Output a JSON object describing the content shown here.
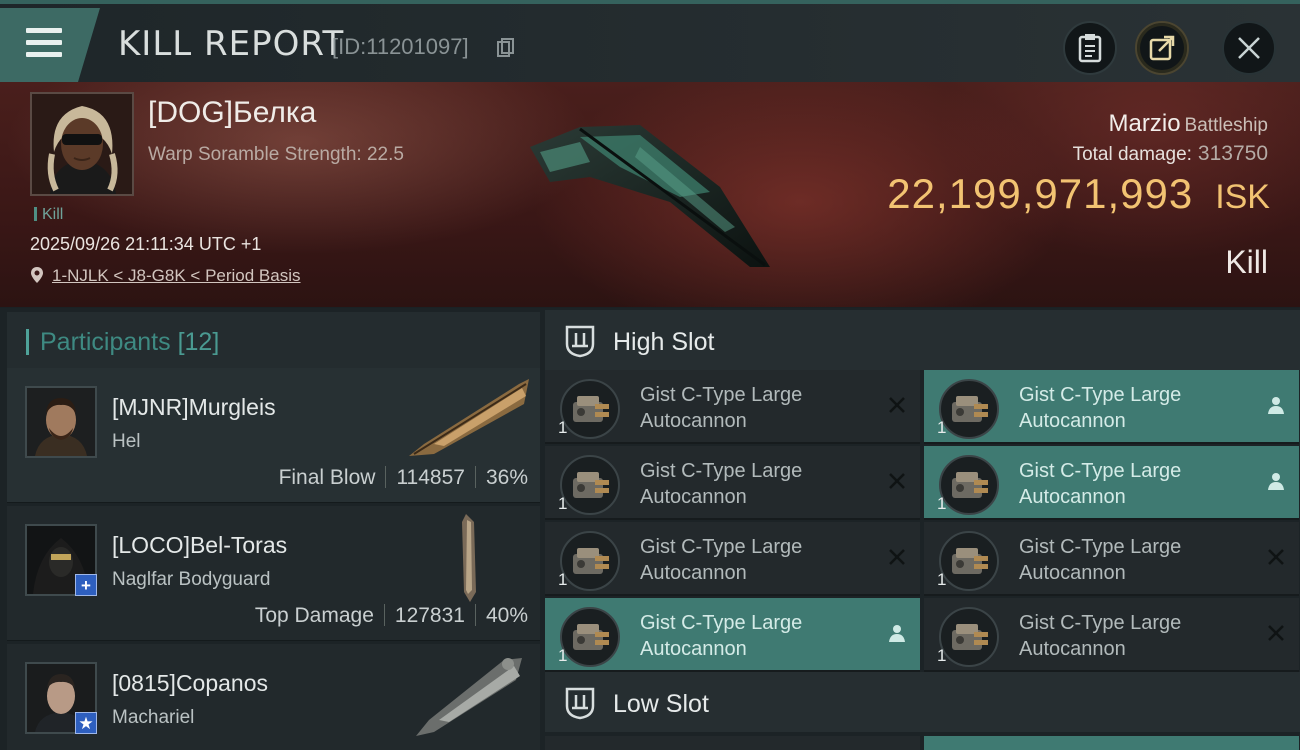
{
  "header": {
    "title": "KILL REPORT",
    "report_id": "[ID:11201097]",
    "icons": [
      "menu-icon",
      "copy-icon",
      "clipboard-icon",
      "share-icon",
      "close-icon"
    ]
  },
  "victim": {
    "name": "[DOG]Белка",
    "warp_scramble": "Warp Soramble Strength: 22.5",
    "tag": "Kill",
    "datetime": "2025/09/26 21:11:34 UTC +1",
    "location": "1-NJLK < J8-G8K < Period Basis",
    "ship_name": "Marzio",
    "ship_class": "Battleship",
    "total_damage_label": "Total damage:",
    "total_damage": "313750",
    "isk_value": "22,199,971,993",
    "isk_unit": "ISK",
    "result": "Kill"
  },
  "participants": {
    "title": "Participants",
    "count": "[12]",
    "items": [
      {
        "name": "[MJNR]Murgleis",
        "ship": "Hel",
        "role": "Final Blow",
        "damage": "114857",
        "percent": "36%",
        "badge": ""
      },
      {
        "name": "[LOCO]Bel-Toras",
        "ship": "Naglfar Bodyguard",
        "role": "Top Damage",
        "damage": "127831",
        "percent": "40%",
        "badge": "+"
      },
      {
        "name": "[0815]Copanos",
        "ship": "Machariel",
        "role": "",
        "damage": "",
        "percent": "",
        "badge": "★"
      }
    ]
  },
  "slots": {
    "high": {
      "title": "High Slot",
      "modules": [
        {
          "name": "Gist C-Type Large Autocannon",
          "qty": "1",
          "active": false,
          "mark": "x"
        },
        {
          "name": "Gist C-Type Large Autocannon",
          "qty": "1",
          "active": true,
          "mark": "pilot"
        },
        {
          "name": "Gist C-Type Large Autocannon",
          "qty": "1",
          "active": false,
          "mark": "x"
        },
        {
          "name": "Gist C-Type Large Autocannon",
          "qty": "1",
          "active": true,
          "mark": "pilot"
        },
        {
          "name": "Gist C-Type Large Autocannon",
          "qty": "1",
          "active": false,
          "mark": "x"
        },
        {
          "name": "Gist C-Type Large Autocannon",
          "qty": "1",
          "active": false,
          "mark": "x"
        },
        {
          "name": "Gist C-Type Large Autocannon",
          "qty": "1",
          "active": true,
          "mark": "pilot"
        },
        {
          "name": "Gist C-Type Large Autocannon",
          "qty": "1",
          "active": false,
          "mark": "x"
        }
      ]
    },
    "low": {
      "title": "Low Slot"
    }
  },
  "colors": {
    "accent_teal": "#3f7a72",
    "isk_gold": "#f2c372",
    "banner_red": "#3a1716",
    "badge_blue": "#2e5fbf"
  }
}
